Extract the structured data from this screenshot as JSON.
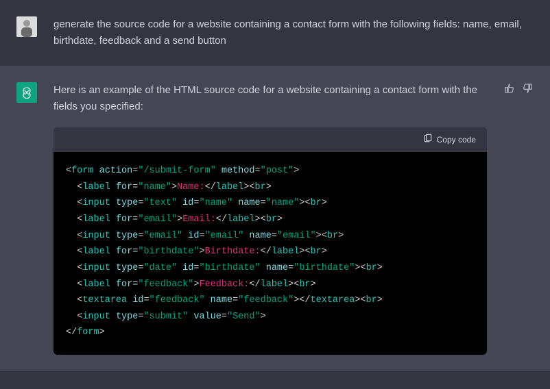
{
  "user_message": "generate the source code for a website containing a contact form with the following fields: name, email, birthdate, feedback and a send button",
  "assistant_intro": "Here is an example of the HTML source code for a website containing a contact form with the fields you specified:",
  "copy_label": "Copy code",
  "code": {
    "form_open": {
      "tag": "form",
      "attrs": [
        [
          "action",
          "/submit-form"
        ],
        [
          "method",
          "post"
        ]
      ]
    },
    "lines": [
      {
        "kind": "label",
        "for": "name",
        "text": "Name:"
      },
      {
        "kind": "input",
        "attrs": [
          [
            "type",
            "text"
          ],
          [
            "id",
            "name"
          ],
          [
            "name",
            "name"
          ]
        ]
      },
      {
        "kind": "label",
        "for": "email",
        "text": "Email:"
      },
      {
        "kind": "input",
        "attrs": [
          [
            "type",
            "email"
          ],
          [
            "id",
            "email"
          ],
          [
            "name",
            "email"
          ]
        ]
      },
      {
        "kind": "label",
        "for": "birthdate",
        "text": "Birthdate:"
      },
      {
        "kind": "input",
        "attrs": [
          [
            "type",
            "date"
          ],
          [
            "id",
            "birthdate"
          ],
          [
            "name",
            "birthdate"
          ]
        ]
      },
      {
        "kind": "label",
        "for": "feedback",
        "text": "Feedback:"
      },
      {
        "kind": "textarea",
        "attrs": [
          [
            "id",
            "feedback"
          ],
          [
            "name",
            "feedback"
          ]
        ]
      },
      {
        "kind": "submit",
        "attrs": [
          [
            "type",
            "submit"
          ],
          [
            "value",
            "Send"
          ]
        ]
      }
    ],
    "form_close": "form"
  }
}
